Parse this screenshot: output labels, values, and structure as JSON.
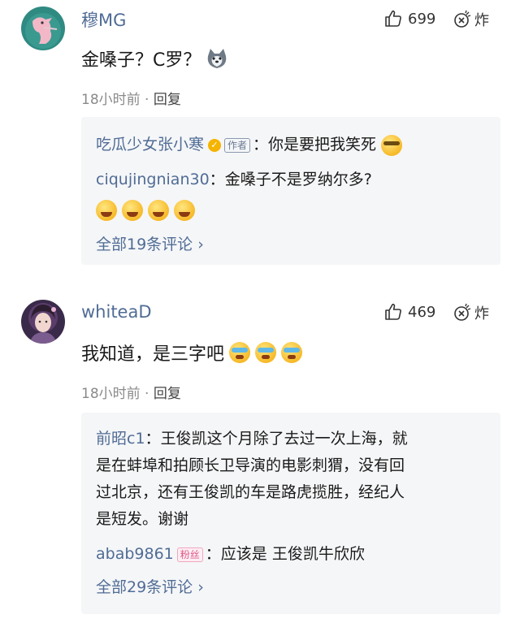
{
  "comments": [
    {
      "username": "穆MG",
      "likes": "699",
      "explode_label": "炸",
      "text": "金嗓子？C罗？",
      "time": "18小时前",
      "dot": "·",
      "reply_label": "回复",
      "replies": [
        {
          "name": "吃瓜少女张小寒",
          "tag": "作者",
          "sep": "：",
          "text": "你是要把我笑死"
        },
        {
          "name": "ciqujingnian30",
          "sep": "：",
          "text": "金嗓子不是罗纳尔多?"
        }
      ],
      "all_link": "全部19条评论 ›"
    },
    {
      "username": "whiteaD",
      "likes": "469",
      "explode_label": "炸",
      "text": "我知道，是三字吧",
      "time": "18小时前",
      "dot": "·",
      "reply_label": "回复",
      "replies": [
        {
          "name": "前昭c1",
          "sep": "：",
          "text_lines": [
            "王俊凯这个月除了去过一次上海，就",
            "是在蚌埠和拍顾长卫导演的电影刺猬，没有回",
            "过北京，还有王俊凯的车是路虎揽胜，经纪人",
            "是短发。谢谢"
          ]
        },
        {
          "name": "abab9861",
          "tag": "粉丝",
          "sep": "：",
          "text": "应该是 王俊凯牛欣欣"
        }
      ],
      "all_link": "全部29条评论 ›"
    }
  ]
}
